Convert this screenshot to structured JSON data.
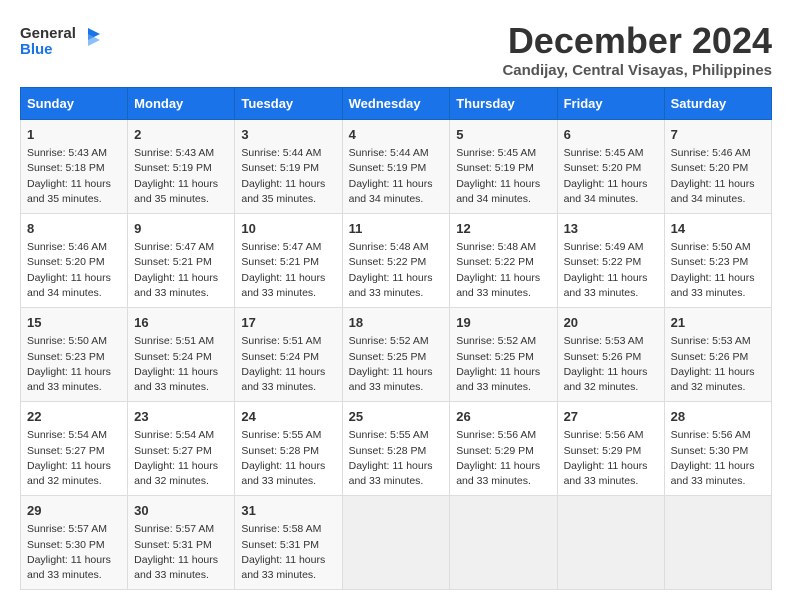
{
  "logo": {
    "line1": "General",
    "line2": "Blue"
  },
  "title": "December 2024",
  "subtitle": "Candijay, Central Visayas, Philippines",
  "days_of_week": [
    "Sunday",
    "Monday",
    "Tuesday",
    "Wednesday",
    "Thursday",
    "Friday",
    "Saturday"
  ],
  "weeks": [
    [
      {
        "day": "1",
        "info": "Sunrise: 5:43 AM\nSunset: 5:18 PM\nDaylight: 11 hours\nand 35 minutes."
      },
      {
        "day": "2",
        "info": "Sunrise: 5:43 AM\nSunset: 5:19 PM\nDaylight: 11 hours\nand 35 minutes."
      },
      {
        "day": "3",
        "info": "Sunrise: 5:44 AM\nSunset: 5:19 PM\nDaylight: 11 hours\nand 35 minutes."
      },
      {
        "day": "4",
        "info": "Sunrise: 5:44 AM\nSunset: 5:19 PM\nDaylight: 11 hours\nand 34 minutes."
      },
      {
        "day": "5",
        "info": "Sunrise: 5:45 AM\nSunset: 5:19 PM\nDaylight: 11 hours\nand 34 minutes."
      },
      {
        "day": "6",
        "info": "Sunrise: 5:45 AM\nSunset: 5:20 PM\nDaylight: 11 hours\nand 34 minutes."
      },
      {
        "day": "7",
        "info": "Sunrise: 5:46 AM\nSunset: 5:20 PM\nDaylight: 11 hours\nand 34 minutes."
      }
    ],
    [
      {
        "day": "8",
        "info": "Sunrise: 5:46 AM\nSunset: 5:20 PM\nDaylight: 11 hours\nand 34 minutes."
      },
      {
        "day": "9",
        "info": "Sunrise: 5:47 AM\nSunset: 5:21 PM\nDaylight: 11 hours\nand 33 minutes."
      },
      {
        "day": "10",
        "info": "Sunrise: 5:47 AM\nSunset: 5:21 PM\nDaylight: 11 hours\nand 33 minutes."
      },
      {
        "day": "11",
        "info": "Sunrise: 5:48 AM\nSunset: 5:22 PM\nDaylight: 11 hours\nand 33 minutes."
      },
      {
        "day": "12",
        "info": "Sunrise: 5:48 AM\nSunset: 5:22 PM\nDaylight: 11 hours\nand 33 minutes."
      },
      {
        "day": "13",
        "info": "Sunrise: 5:49 AM\nSunset: 5:22 PM\nDaylight: 11 hours\nand 33 minutes."
      },
      {
        "day": "14",
        "info": "Sunrise: 5:50 AM\nSunset: 5:23 PM\nDaylight: 11 hours\nand 33 minutes."
      }
    ],
    [
      {
        "day": "15",
        "info": "Sunrise: 5:50 AM\nSunset: 5:23 PM\nDaylight: 11 hours\nand 33 minutes."
      },
      {
        "day": "16",
        "info": "Sunrise: 5:51 AM\nSunset: 5:24 PM\nDaylight: 11 hours\nand 33 minutes."
      },
      {
        "day": "17",
        "info": "Sunrise: 5:51 AM\nSunset: 5:24 PM\nDaylight: 11 hours\nand 33 minutes."
      },
      {
        "day": "18",
        "info": "Sunrise: 5:52 AM\nSunset: 5:25 PM\nDaylight: 11 hours\nand 33 minutes."
      },
      {
        "day": "19",
        "info": "Sunrise: 5:52 AM\nSunset: 5:25 PM\nDaylight: 11 hours\nand 33 minutes."
      },
      {
        "day": "20",
        "info": "Sunrise: 5:53 AM\nSunset: 5:26 PM\nDaylight: 11 hours\nand 32 minutes."
      },
      {
        "day": "21",
        "info": "Sunrise: 5:53 AM\nSunset: 5:26 PM\nDaylight: 11 hours\nand 32 minutes."
      }
    ],
    [
      {
        "day": "22",
        "info": "Sunrise: 5:54 AM\nSunset: 5:27 PM\nDaylight: 11 hours\nand 32 minutes."
      },
      {
        "day": "23",
        "info": "Sunrise: 5:54 AM\nSunset: 5:27 PM\nDaylight: 11 hours\nand 32 minutes."
      },
      {
        "day": "24",
        "info": "Sunrise: 5:55 AM\nSunset: 5:28 PM\nDaylight: 11 hours\nand 33 minutes."
      },
      {
        "day": "25",
        "info": "Sunrise: 5:55 AM\nSunset: 5:28 PM\nDaylight: 11 hours\nand 33 minutes."
      },
      {
        "day": "26",
        "info": "Sunrise: 5:56 AM\nSunset: 5:29 PM\nDaylight: 11 hours\nand 33 minutes."
      },
      {
        "day": "27",
        "info": "Sunrise: 5:56 AM\nSunset: 5:29 PM\nDaylight: 11 hours\nand 33 minutes."
      },
      {
        "day": "28",
        "info": "Sunrise: 5:56 AM\nSunset: 5:30 PM\nDaylight: 11 hours\nand 33 minutes."
      }
    ],
    [
      {
        "day": "29",
        "info": "Sunrise: 5:57 AM\nSunset: 5:30 PM\nDaylight: 11 hours\nand 33 minutes."
      },
      {
        "day": "30",
        "info": "Sunrise: 5:57 AM\nSunset: 5:31 PM\nDaylight: 11 hours\nand 33 minutes."
      },
      {
        "day": "31",
        "info": "Sunrise: 5:58 AM\nSunset: 5:31 PM\nDaylight: 11 hours\nand 33 minutes."
      },
      {
        "day": "",
        "info": ""
      },
      {
        "day": "",
        "info": ""
      },
      {
        "day": "",
        "info": ""
      },
      {
        "day": "",
        "info": ""
      }
    ]
  ]
}
